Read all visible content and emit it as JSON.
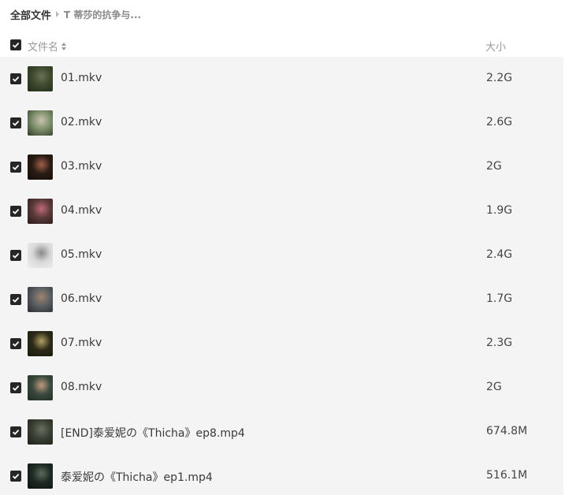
{
  "breadcrumb": {
    "root": "全部文件",
    "current": "T 蒂莎的抗争与..."
  },
  "header": {
    "name_label": "文件名",
    "size_label": "大小"
  },
  "files": [
    {
      "name": "01.mkv",
      "size": "2.2G",
      "thumb": [
        "#3d4a2e",
        "#6b7152",
        "#222a1a"
      ]
    },
    {
      "name": "02.mkv",
      "size": "2.6G",
      "thumb": [
        "#7d8f6a",
        "#c9c3b0",
        "#2d3a28"
      ]
    },
    {
      "name": "03.mkv",
      "size": "2G",
      "thumb": [
        "#2a1c14",
        "#a0604a",
        "#140c08"
      ]
    },
    {
      "name": "04.mkv",
      "size": "1.9G",
      "thumb": [
        "#5a3a3a",
        "#c06a7a",
        "#2a1818"
      ]
    },
    {
      "name": "05.mkv",
      "size": "2.4G",
      "thumb": [
        "#d8d8d8",
        "#8a8a8a",
        "#f0f0f0"
      ]
    },
    {
      "name": "06.mkv",
      "size": "1.7G",
      "thumb": [
        "#5a5e62",
        "#a08470",
        "#2a2c2e"
      ]
    },
    {
      "name": "07.mkv",
      "size": "2.3G",
      "thumb": [
        "#2c2a18",
        "#b0a060",
        "#1a1808"
      ]
    },
    {
      "name": "08.mkv",
      "size": "2G",
      "thumb": [
        "#3a4a3e",
        "#c09a80",
        "#1e2a22"
      ]
    },
    {
      "name": "[END]泰爱妮の《Thicha》ep8.mp4",
      "size": "674.8M",
      "thumb": [
        "#3a4034",
        "#6a7060",
        "#1c2018"
      ]
    },
    {
      "name": "泰爱妮の《Thicha》ep1.mp4",
      "size": "516.1M",
      "thumb": [
        "#1e2a24",
        "#5a6a5a",
        "#0e1410"
      ]
    }
  ]
}
